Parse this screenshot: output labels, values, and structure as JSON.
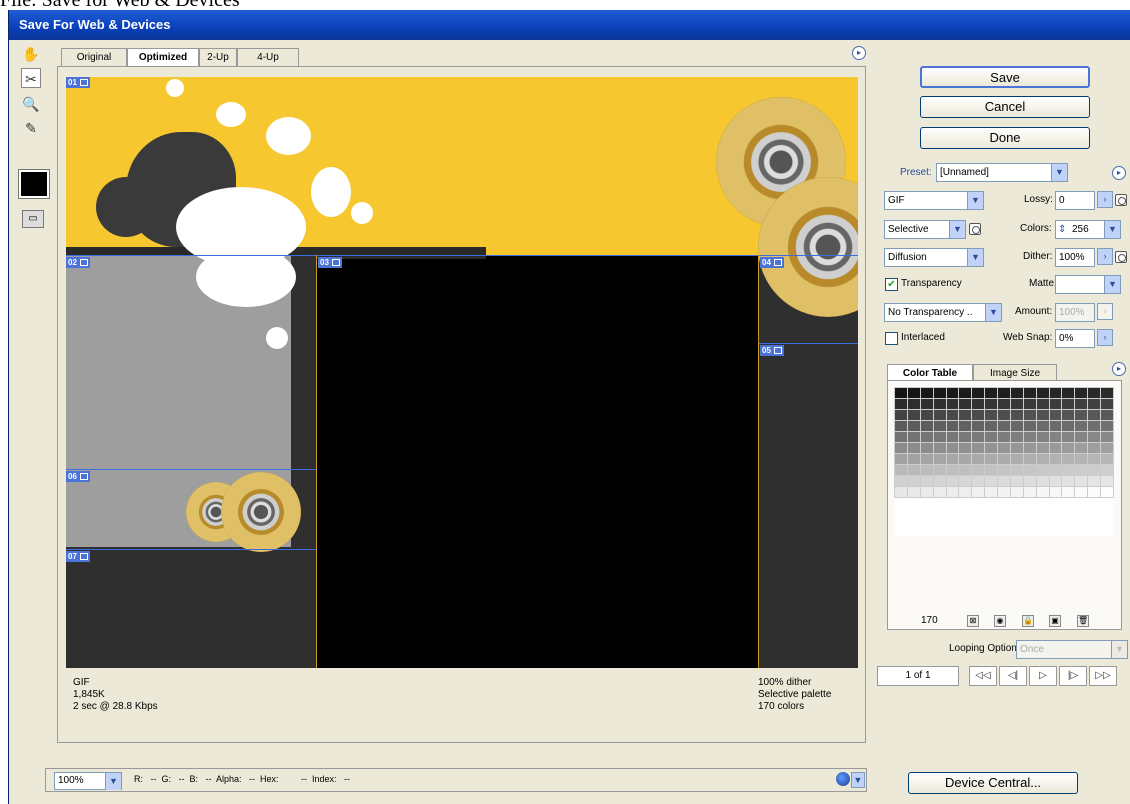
{
  "heading": "File: Save for Web & Devices",
  "window": {
    "title": "Save For Web & Devices"
  },
  "view_tabs": [
    "Original",
    "Optimized",
    "2-Up",
    "4-Up"
  ],
  "active_tab": "Optimized",
  "tools": [
    "hand-tool-icon",
    "slice-select-tool-icon",
    "zoom-tool-icon",
    "eyedropper-tool-icon"
  ],
  "slices": [
    "01",
    "02",
    "03",
    "04",
    "05",
    "06",
    "07"
  ],
  "stats_left": {
    "format": "GIF",
    "size": "1,845K",
    "time": "2 sec @ 28.8 Kbps"
  },
  "stats_right": {
    "dither": "100% dither",
    "palette": "Selective palette",
    "colors": "170 colors"
  },
  "buttons": {
    "save": "Save",
    "cancel": "Cancel",
    "done": "Done",
    "device_central": "Device Central..."
  },
  "settings": {
    "preset_label": "Preset:",
    "preset_value": "[Unnamed]",
    "format": "GIF",
    "lossy_label": "Lossy:",
    "lossy_value": "0",
    "reduction": "Selective",
    "colors_label": "Colors:",
    "colors_value": "256",
    "dither_algo": "Diffusion",
    "dither_label": "Dither:",
    "dither_value": "100%",
    "transparency_label": "Transparency",
    "transparency_checked": true,
    "matte_label": "Matte:",
    "transparency_dither": "No Transparency ..",
    "amount_label": "Amount:",
    "amount_value": "100%",
    "interlaced_label": "Interlaced",
    "interlaced_checked": false,
    "websnap_label": "Web Snap:",
    "websnap_value": "0%"
  },
  "color_table": {
    "tabs": [
      "Color Table",
      "Image Size"
    ],
    "count": "170"
  },
  "looping": {
    "label": "Looping Options:",
    "value": "Once"
  },
  "animation": {
    "frame": "1 of 1"
  },
  "bottom": {
    "zoom": "100%",
    "readout": "R:   --  G:   --  B:   --  Alpha:   --  Hex:         --  Index:   --"
  },
  "colors": {
    "accent": "#4c74d8",
    "yellow": "#f6c72e",
    "titlebar": "#0a3fb8"
  }
}
